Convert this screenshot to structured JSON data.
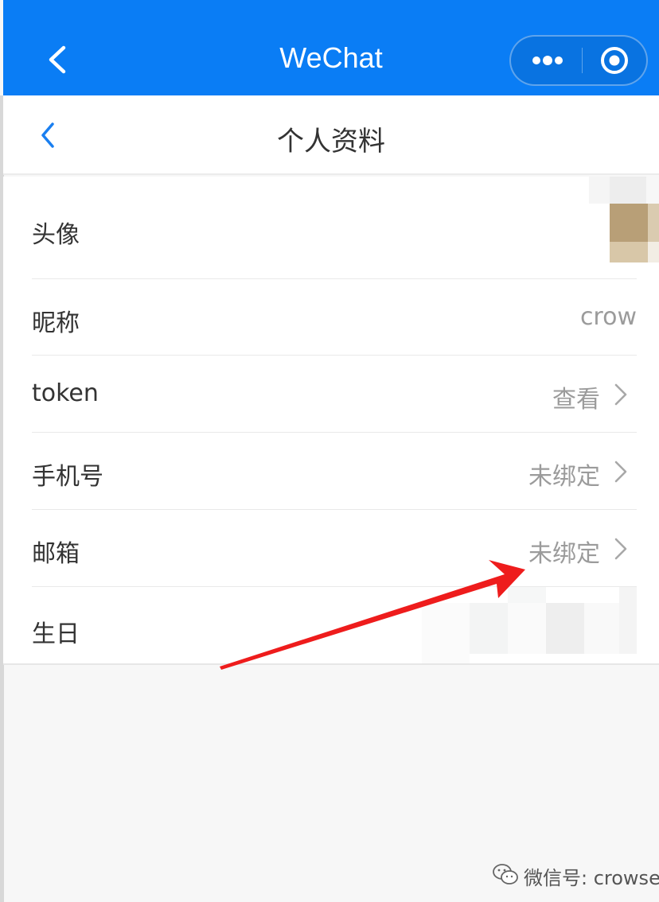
{
  "app_bar": {
    "title": "WeChat",
    "back_icon": "chevron-left-icon",
    "more_icon": "more-dots-icon",
    "close_icon": "target-circle-icon",
    "color": "#0a7df5"
  },
  "page": {
    "title": "个人资料",
    "back_icon": "chevron-left-icon",
    "accent": "#1a7ff0"
  },
  "profile_rows": [
    {
      "label": "头像",
      "value": ""
    },
    {
      "label": "昵称",
      "value": "crow"
    },
    {
      "label": "token",
      "value": "查看"
    },
    {
      "label": "手机号",
      "value": "未绑定"
    },
    {
      "label": "邮箱",
      "value": "未绑定"
    },
    {
      "label": "生日",
      "value": ""
    }
  ],
  "annotation": {
    "color": "#ee1c1c"
  },
  "watermark": {
    "text": "微信号: crowsec"
  }
}
